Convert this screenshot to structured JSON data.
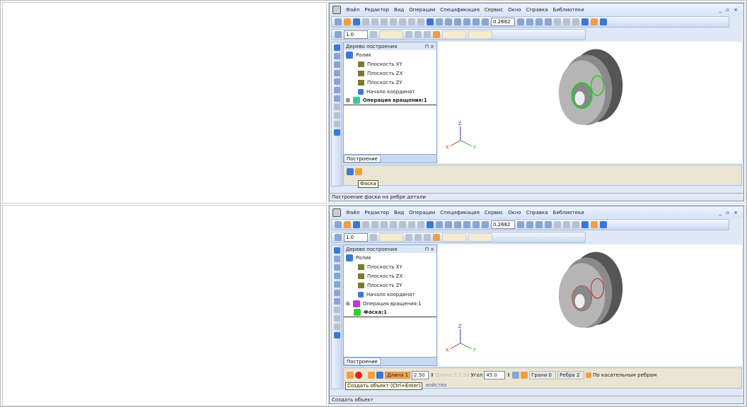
{
  "menu": [
    "Файл",
    "Редактор",
    "Вид",
    "Операции",
    "Спецификация",
    "Сервис",
    "Окно",
    "Справка",
    "Библиотеки"
  ],
  "window_controls": "_ ▫ ×",
  "toolbar": {
    "zoom": "0.2682",
    "step": "1.0"
  },
  "tree": {
    "title": "Дерево построения",
    "controls": "⊓ ×",
    "root": "Ролик",
    "planes": [
      "Плоскость XY",
      "Плоскость ZX",
      "Плоскость ZY"
    ],
    "origin": "Начало координат",
    "operation": "Операция вращения:1",
    "chamfer": "Фаска:1",
    "tab": "Построение"
  },
  "axes": {
    "x": "X",
    "y": "Y",
    "z": "Z"
  },
  "panel1": {
    "tooltip": "Фаска",
    "status": "Построение фаски на ребре детали"
  },
  "panel2": {
    "length1_label": "Длина 1",
    "length1": "2.50",
    "length2_label": "Длина 2",
    "length2": "2.50",
    "angle_label": "Угол",
    "angle": "45.0",
    "faces": "Грани 0",
    "edges": "Ребра 2",
    "tangent_label": "По касательным ребрам",
    "tooltip": "Создать объект (Ctrl+Enter)",
    "tab_partial": "войства",
    "status": "Создать объект"
  }
}
